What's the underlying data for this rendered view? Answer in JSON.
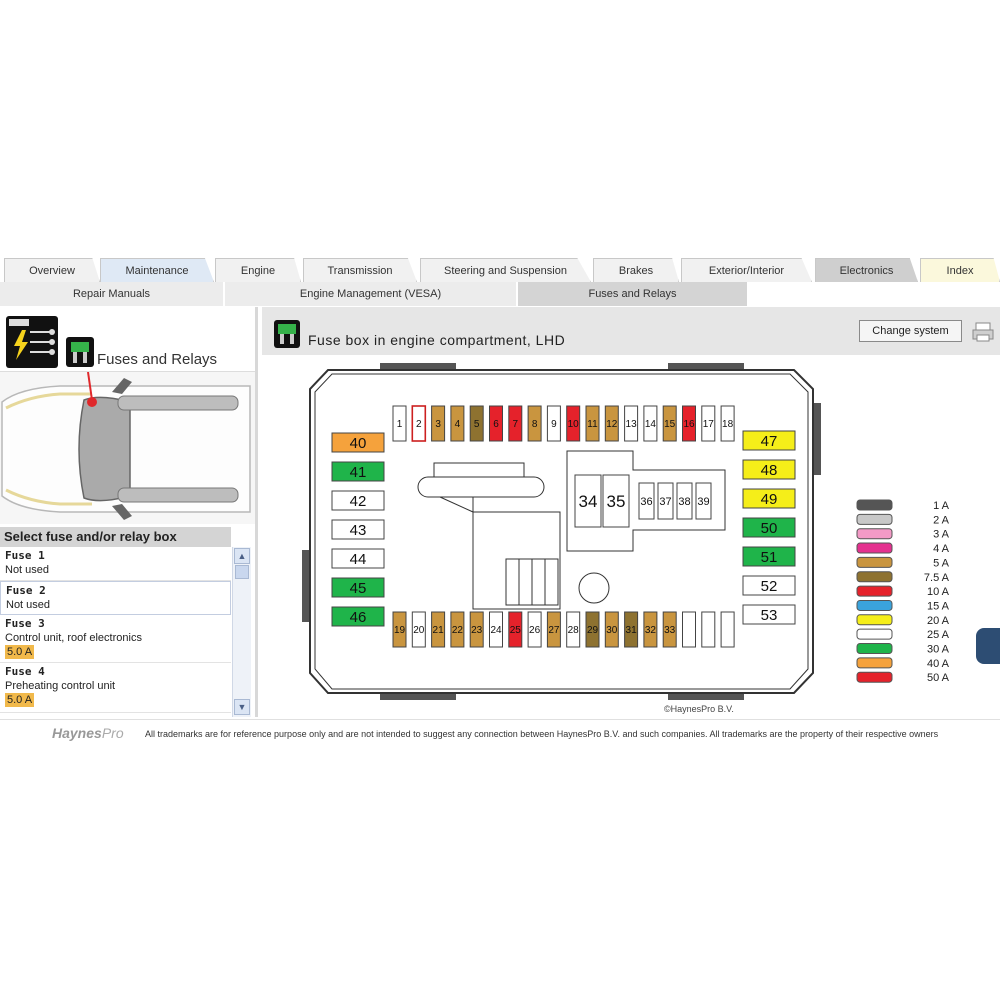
{
  "tabs": [
    {
      "label": "Overview"
    },
    {
      "label": "Maintenance"
    },
    {
      "label": "Engine"
    },
    {
      "label": "Transmission"
    },
    {
      "label": "Steering and Suspension"
    },
    {
      "label": "Brakes"
    },
    {
      "label": "Exterior/Interior"
    },
    {
      "label": "Electronics"
    },
    {
      "label": "Index"
    }
  ],
  "subtabs": [
    {
      "label": "Repair Manuals"
    },
    {
      "label": "Engine Management (VESA)"
    },
    {
      "label": "Fuses and Relays"
    }
  ],
  "left": {
    "title": "Fuses and Relays",
    "select_heading": "Select fuse and/or relay box",
    "fuses": [
      {
        "name": "Fuse 1",
        "desc": "Not used",
        "amp": ""
      },
      {
        "name": "Fuse 2",
        "desc": "Not used",
        "amp": ""
      },
      {
        "name": "Fuse 3",
        "desc": "Control unit, roof electronics",
        "amp": "5.0 A"
      },
      {
        "name": "Fuse 4",
        "desc": "Preheating control unit",
        "amp": "5.0 A"
      }
    ]
  },
  "main": {
    "title": "Fuse box in engine compartment, LHD",
    "change_button": "Change system",
    "copyright": "©HaynesPro B.V.",
    "top_fuses": [
      {
        "n": "1",
        "c": "#ffffff"
      },
      {
        "n": "2",
        "c": "#ffffff",
        "b": "#cc2020"
      },
      {
        "n": "3",
        "c": "#c9953f"
      },
      {
        "n": "4",
        "c": "#c9953f"
      },
      {
        "n": "5",
        "c": "#8e7230"
      },
      {
        "n": "6",
        "c": "#e5222b"
      },
      {
        "n": "7",
        "c": "#e5222b"
      },
      {
        "n": "8",
        "c": "#c9953f"
      },
      {
        "n": "9",
        "c": "#ffffff"
      },
      {
        "n": "10",
        "c": "#e5222b"
      },
      {
        "n": "11",
        "c": "#c9953f"
      },
      {
        "n": "12",
        "c": "#c9953f"
      },
      {
        "n": "13",
        "c": "#ffffff"
      },
      {
        "n": "14",
        "c": "#ffffff"
      },
      {
        "n": "15",
        "c": "#c9953f"
      },
      {
        "n": "16",
        "c": "#e5222b"
      },
      {
        "n": "17",
        "c": "#ffffff"
      },
      {
        "n": "18",
        "c": "#ffffff"
      }
    ],
    "bottom_fuses": [
      {
        "n": "19",
        "c": "#c9953f"
      },
      {
        "n": "20",
        "c": "#ffffff"
      },
      {
        "n": "21",
        "c": "#c9953f"
      },
      {
        "n": "22",
        "c": "#c9953f"
      },
      {
        "n": "23",
        "c": "#c9953f"
      },
      {
        "n": "24",
        "c": "#ffffff"
      },
      {
        "n": "25",
        "c": "#e5222b"
      },
      {
        "n": "26",
        "c": "#ffffff"
      },
      {
        "n": "27",
        "c": "#c9953f"
      },
      {
        "n": "28",
        "c": "#ffffff"
      },
      {
        "n": "29",
        "c": "#8e7230"
      },
      {
        "n": "30",
        "c": "#c9953f"
      },
      {
        "n": "31",
        "c": "#8e7230"
      },
      {
        "n": "32",
        "c": "#c9953f"
      },
      {
        "n": "33",
        "c": "#c9953f"
      },
      {
        "n": "",
        "c": "#ffffff"
      },
      {
        "n": "",
        "c": "#ffffff"
      },
      {
        "n": "",
        "c": "#ffffff"
      }
    ],
    "left_fuses": [
      {
        "n": "40",
        "c": "#f5a23c"
      },
      {
        "n": "41",
        "c": "#1fb44a"
      },
      {
        "n": "42",
        "c": "#ffffff"
      },
      {
        "n": "43",
        "c": "#ffffff"
      },
      {
        "n": "44",
        "c": "#ffffff"
      },
      {
        "n": "45",
        "c": "#1fb44a"
      },
      {
        "n": "46",
        "c": "#1fb44a"
      }
    ],
    "right_fuses": [
      {
        "n": "47",
        "c": "#f5ee19"
      },
      {
        "n": "48",
        "c": "#f5ee19"
      },
      {
        "n": "49",
        "c": "#f5ee19"
      },
      {
        "n": "50",
        "c": "#1fb44a"
      },
      {
        "n": "51",
        "c": "#1fb44a"
      },
      {
        "n": "52",
        "c": "#ffffff"
      },
      {
        "n": "53",
        "c": "#ffffff"
      }
    ],
    "relays": [
      {
        "n": "34"
      },
      {
        "n": "35"
      },
      {
        "n": "36"
      },
      {
        "n": "37"
      },
      {
        "n": "38"
      },
      {
        "n": "39"
      }
    ],
    "legend": [
      {
        "label": "1 A",
        "c": "#555555"
      },
      {
        "label": "2 A",
        "c": "#c8c8c8"
      },
      {
        "label": "3 A",
        "c": "#f39ac6"
      },
      {
        "label": "4 A",
        "c": "#e4318f"
      },
      {
        "label": "5 A",
        "c": "#c9953f"
      },
      {
        "label": "7.5 A",
        "c": "#8e7230"
      },
      {
        "label": "10 A",
        "c": "#e5222b"
      },
      {
        "label": "15 A",
        "c": "#3aa3dc"
      },
      {
        "label": "20 A",
        "c": "#f5ee19"
      },
      {
        "label": "25 A",
        "c": "#ffffff"
      },
      {
        "label": "30 A",
        "c": "#1fb44a"
      },
      {
        "label": "40 A",
        "c": "#f5a23c"
      },
      {
        "label": "50 A",
        "c": "#e5222b"
      }
    ]
  },
  "footer": {
    "logo_main": "Haynes",
    "logo_pro": "Pro",
    "disclaimer": "All trademarks are for reference purpose only and are not intended to suggest any connection between HaynesPro B.V. and such companies. All trademarks are the property of their respective owners"
  }
}
